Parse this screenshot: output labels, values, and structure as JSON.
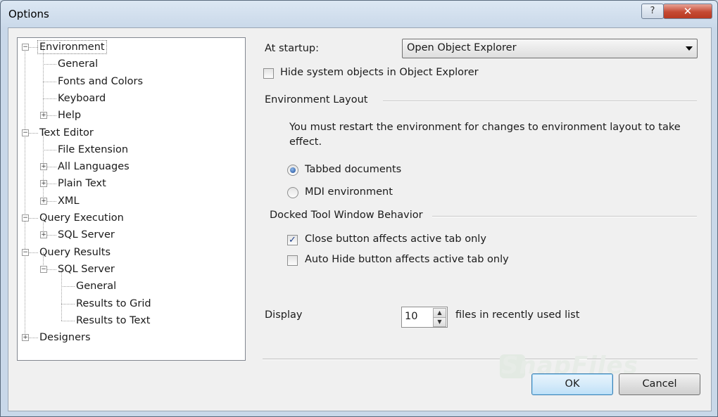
{
  "window": {
    "title": "Options",
    "help_glyph": "?",
    "close_glyph": "✕"
  },
  "tree": {
    "items": [
      {
        "label": "Environment",
        "expander": "minus"
      },
      {
        "label": "General"
      },
      {
        "label": "Fonts and Colors"
      },
      {
        "label": "Keyboard"
      },
      {
        "label": "Help",
        "expander": "plus"
      },
      {
        "label": "Text Editor",
        "expander": "minus"
      },
      {
        "label": "File Extension"
      },
      {
        "label": "All Languages",
        "expander": "plus"
      },
      {
        "label": "Plain Text",
        "expander": "plus"
      },
      {
        "label": "XML",
        "expander": "plus"
      },
      {
        "label": "Query Execution",
        "expander": "minus"
      },
      {
        "label": "SQL Server",
        "expander": "plus"
      },
      {
        "label": "Query Results",
        "expander": "minus"
      },
      {
        "label": "SQL Server",
        "expander": "minus"
      },
      {
        "label": "General"
      },
      {
        "label": "Results to Grid"
      },
      {
        "label": "Results to Text"
      },
      {
        "label": "Designers",
        "expander": "plus"
      }
    ],
    "selected_index": 0
  },
  "settings": {
    "startup_label": "At startup:",
    "startup_value": "Open Object Explorer",
    "hide_system_label": "Hide system objects in Object Explorer",
    "hide_system_checked": false,
    "env_layout_heading": "Environment Layout",
    "restart_note": "You must restart the environment for changes to environment layout to take effect.",
    "radio_tabbed": "Tabbed documents",
    "radio_mdi": "MDI environment",
    "selected_layout": "Tabbed documents",
    "docked_heading": "Docked Tool Window Behavior",
    "close_btn_label": "Close button affects active tab only",
    "close_btn_checked": true,
    "autohide_label": "Auto Hide button affects active tab only",
    "autohide_checked": false,
    "display_label": "Display",
    "display_value": "10",
    "recent_suffix": "files in recently used list"
  },
  "buttons": {
    "ok": "OK",
    "cancel": "Cancel"
  },
  "watermark": "SnapFiles"
}
